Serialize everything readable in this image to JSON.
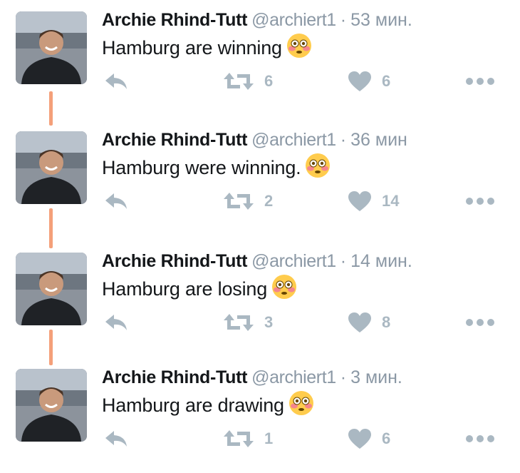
{
  "tweets": [
    {
      "name": "Archie Rhind-Tutt",
      "handle": "@archiert1",
      "separator": "·",
      "time": "53 мин.",
      "text": "Hamburg are winning",
      "emoji": "flushed-face",
      "retweets": "6",
      "likes": "6"
    },
    {
      "name": "Archie Rhind-Tutt",
      "handle": "@archiert1",
      "separator": "·",
      "time": "36 мин",
      "text": "Hamburg were winning.",
      "emoji": "flushed-face",
      "retweets": "2",
      "likes": "14"
    },
    {
      "name": "Archie Rhind-Tutt",
      "handle": "@archiert1",
      "separator": "·",
      "time": "14 мин.",
      "text": "Hamburg are losing",
      "emoji": "flushed-face",
      "retweets": "3",
      "likes": "8"
    },
    {
      "name": "Archie Rhind-Tutt",
      "handle": "@archiert1",
      "separator": "·",
      "time": "3 мин.",
      "text": "Hamburg are drawing",
      "emoji": "flushed-face",
      "retweets": "1",
      "likes": "6"
    }
  ],
  "icons": {
    "reply": "reply-icon",
    "retweet": "retweet-icon",
    "like": "heart-icon",
    "more": "more-icon"
  },
  "colors": {
    "icon": "#aab8c2",
    "thread_line": "#f4a07a",
    "text": "#14171a",
    "secondary": "#8b98a5"
  }
}
